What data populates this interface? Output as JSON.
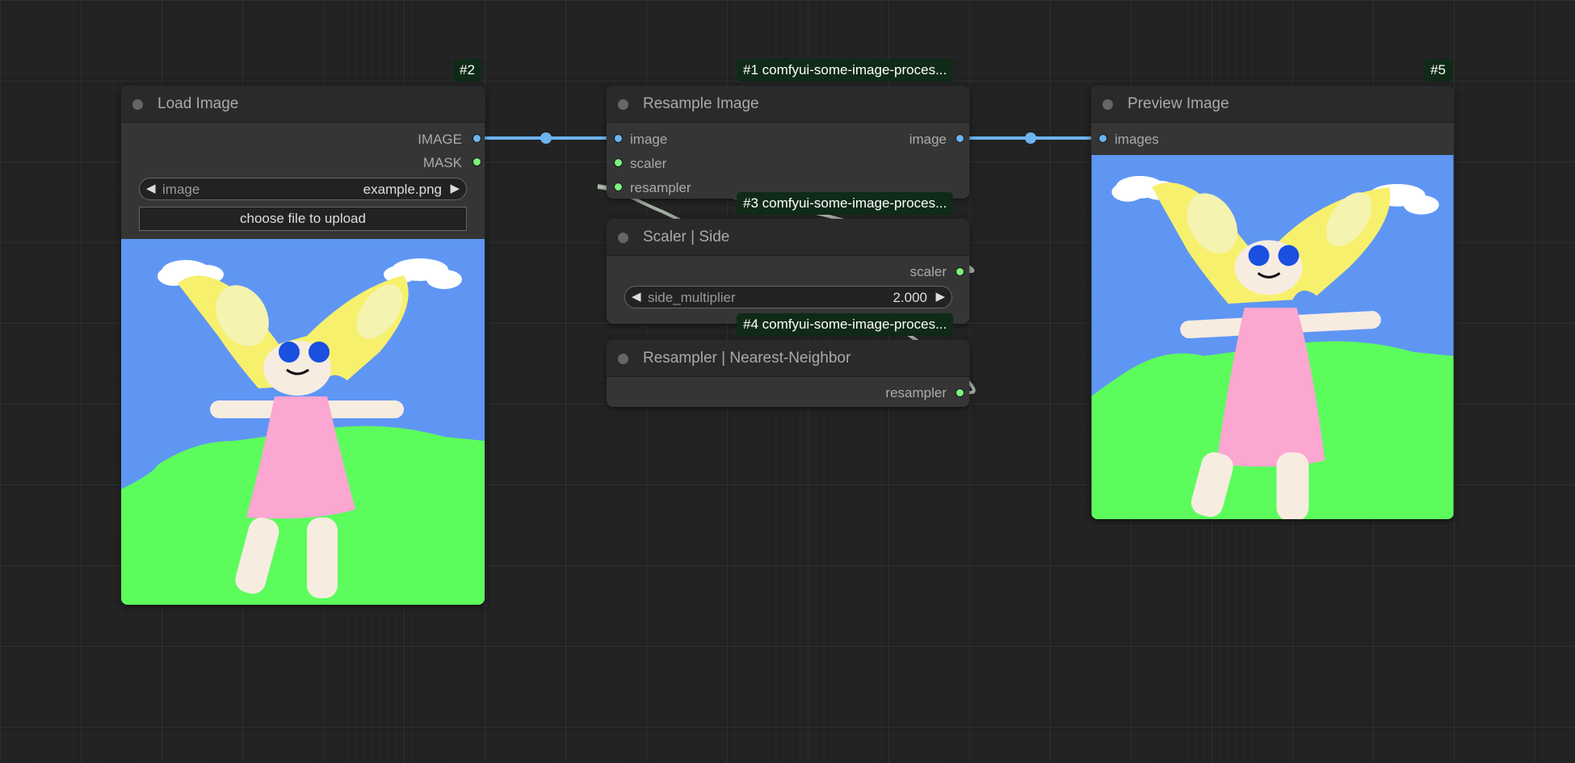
{
  "nodes": {
    "load_image": {
      "badge": "#2",
      "title": "Load Image",
      "outputs": [
        "IMAGE",
        "MASK"
      ],
      "widget_label": "image",
      "widget_value": "example.png",
      "upload_label": "choose file to upload"
    },
    "resample_image": {
      "badge": "#1 comfyui-some-image-proces...",
      "title": "Resample Image",
      "inputs": [
        "image",
        "scaler",
        "resampler"
      ],
      "outputs": [
        "image"
      ]
    },
    "scaler_side": {
      "badge": "#3 comfyui-some-image-proces...",
      "title": "Scaler | Side",
      "outputs": [
        "scaler"
      ],
      "widget_label": "side_multiplier",
      "widget_value": "2.000"
    },
    "resampler_nn": {
      "badge": "#4 comfyui-some-image-proces...",
      "title": "Resampler | Nearest-Neighbor",
      "outputs": [
        "resampler"
      ]
    },
    "preview_image": {
      "badge": "#5",
      "title": "Preview Image",
      "inputs": [
        "images"
      ]
    }
  },
  "colors": {
    "image_link": "#6cb4f0",
    "scaler_link": "#7cf27c",
    "canvas_bg": "#222222",
    "node_bg": "#353535",
    "badge_bg": "#0f2a17"
  },
  "icons": {
    "title_dot": "collapse-dot-icon",
    "widget_left": "arrow-left-icon",
    "widget_right": "arrow-right-icon"
  }
}
